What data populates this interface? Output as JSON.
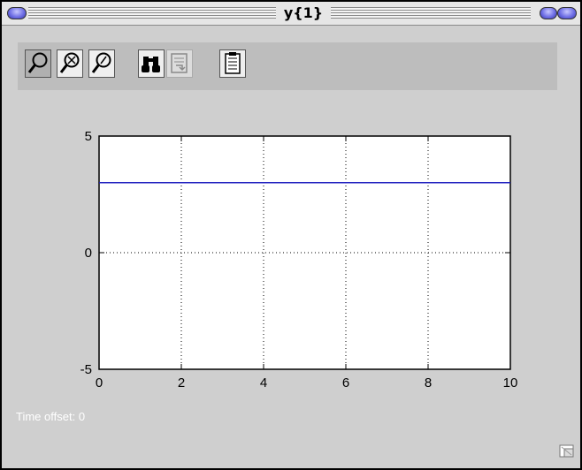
{
  "window": {
    "title": "y{1}"
  },
  "toolbar": {
    "buttons": [
      {
        "name": "zoom-icon",
        "tooltip": "Zoom"
      },
      {
        "name": "zoom-x-icon",
        "tooltip": "Zoom X"
      },
      {
        "name": "zoom-y-icon",
        "tooltip": "Zoom Y"
      },
      {
        "name": "binoculars-icon",
        "tooltip": "Autoscale"
      },
      {
        "name": "save-axes-icon",
        "tooltip": "Save axes settings",
        "disabled": true
      },
      {
        "name": "parameters-icon",
        "tooltip": "Parameters"
      }
    ]
  },
  "chart_data": {
    "type": "line",
    "title": "",
    "xlabel": "",
    "ylabel": "",
    "xlim": [
      0,
      10
    ],
    "ylim": [
      -5,
      5
    ],
    "xticks": [
      "0",
      "2",
      "4",
      "6",
      "8",
      "10"
    ],
    "yticks": [
      "5",
      "0",
      "-5"
    ],
    "grid": true,
    "series": [
      {
        "color": "#1f1fbf",
        "x": [
          0,
          10
        ],
        "y": [
          3,
          3
        ]
      }
    ]
  },
  "status": {
    "time_offset_label": "Time offset:",
    "time_offset_value": "0"
  },
  "colors": {
    "window_bg": "#cfcfcf",
    "toolbar_bg": "#bdbdbd",
    "plot_bg": "#ffffff",
    "line": "#1f1fbf"
  }
}
